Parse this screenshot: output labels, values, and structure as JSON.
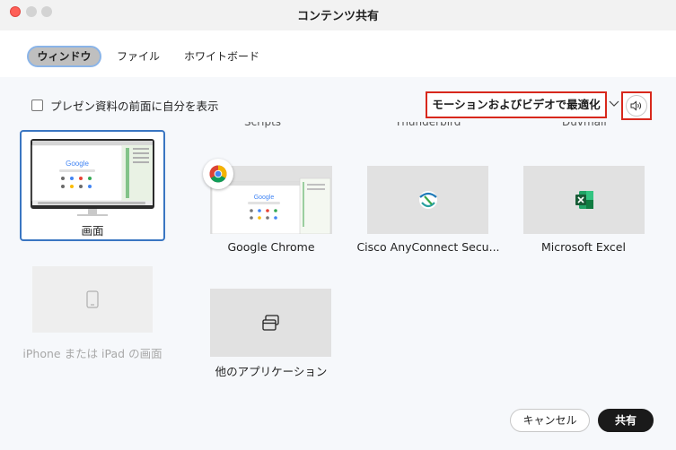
{
  "window": {
    "title": "コンテンツ共有"
  },
  "tabs": [
    {
      "label": "ウィンドウ",
      "active": true
    },
    {
      "label": "ファイル",
      "active": false
    },
    {
      "label": "ホワイトボード",
      "active": false
    }
  ],
  "options": {
    "present_checkbox_label": "プレゼン資料の前面に自分を表示",
    "present_checkbox_checked": false,
    "optimize_mode": "モーションおよびビデオで最適化",
    "audio_icon": "speaker-icon"
  },
  "truncated_labels": [
    "Scripts",
    "Thunderbird",
    "Duvmail"
  ],
  "sources": {
    "screen": {
      "label": "画面",
      "selected": true
    },
    "iphone": {
      "label": "iPhone または iPad の画面",
      "enabled": false
    }
  },
  "apps": [
    {
      "label": "Google Chrome",
      "icon": "chrome-icon"
    },
    {
      "label": "Cisco AnyConnect Secu...",
      "icon": "cisco-anyconnect-icon"
    },
    {
      "label": "Microsoft Excel",
      "icon": "excel-icon"
    },
    {
      "label": "他のアプリケーション",
      "icon": "windows-stack-icon"
    }
  ],
  "screen_preview": {
    "logo_text": "Google"
  },
  "footer": {
    "cancel_label": "キャンセル",
    "share_label": "共有"
  },
  "colors": {
    "highlight": "#d8281c",
    "selection": "#3a76c2",
    "share_button": "#1a1a1a"
  }
}
